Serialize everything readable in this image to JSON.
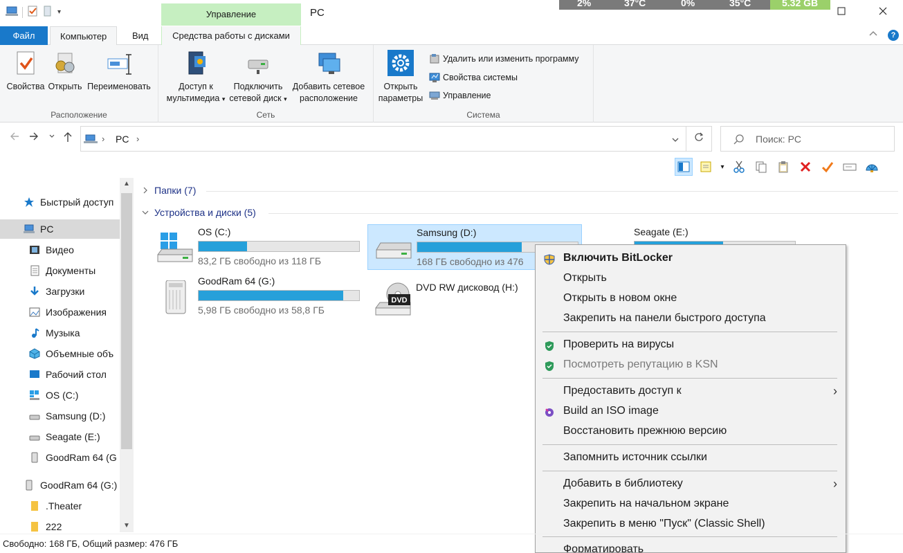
{
  "titlebar": {
    "context_tab": "Управление",
    "window_title": "PC",
    "perf": [
      "2%",
      "37°C",
      "0%",
      "35°C",
      "5.32 GB"
    ]
  },
  "tabs": {
    "file": "Файл",
    "computer": "Компьютер",
    "view": "Вид",
    "disk_tools": "Средства работы с дисками"
  },
  "ribbon": {
    "location": {
      "label": "Расположение",
      "properties": "Свойства",
      "open": "Открыть",
      "rename": "Переименовать"
    },
    "network": {
      "label": "Сеть",
      "media_line1": "Доступ к",
      "media_line2": "мультимедиа",
      "map_line1": "Подключить",
      "map_line2": "сетевой диск",
      "add_line1": "Добавить сетевое",
      "add_line2": "расположение"
    },
    "system": {
      "label": "Система",
      "settings_line1": "Открыть",
      "settings_line2": "параметры",
      "uninstall": "Удалить или изменить программу",
      "sysprops": "Свойства системы",
      "manage": "Управление"
    }
  },
  "address": {
    "path_item": "PC",
    "search_placeholder": "Поиск: PC"
  },
  "sidebar": {
    "items": [
      {
        "label": "Быстрый доступ",
        "icon": "star-icon"
      },
      {
        "label": "PC",
        "icon": "computer-icon"
      },
      {
        "label": "Видео",
        "icon": "video-icon"
      },
      {
        "label": "Документы",
        "icon": "documents-icon"
      },
      {
        "label": "Загрузки",
        "icon": "download-icon"
      },
      {
        "label": "Изображения",
        "icon": "pictures-icon"
      },
      {
        "label": "Музыка",
        "icon": "music-icon"
      },
      {
        "label": "Объемные объ",
        "icon": "3d-objects-icon"
      },
      {
        "label": "Рабочий стол",
        "icon": "desktop-icon"
      },
      {
        "label": "OS (C:)",
        "icon": "windows-drive-icon"
      },
      {
        "label": "Samsung (D:)",
        "icon": "drive-icon"
      },
      {
        "label": "Seagate (E:)",
        "icon": "drive-icon"
      },
      {
        "label": "GoodRam 64 (G",
        "icon": "usb-drive-icon"
      },
      {
        "label": "GoodRam 64 (G:)",
        "icon": "usb-drive-icon"
      },
      {
        "label": ".Theater",
        "icon": "folder-icon"
      },
      {
        "label": "222",
        "icon": "folder-icon"
      }
    ]
  },
  "content": {
    "folders_header": "Папки (7)",
    "devices_header": "Устройства и диски (5)",
    "drives": [
      {
        "name": "OS (C:)",
        "free": "83,2 ГБ свободно из 118 ГБ",
        "used_fraction": 0.3
      },
      {
        "name": "Samsung (D:)",
        "free": "168 ГБ свободно из 476",
        "used_fraction": 0.65
      },
      {
        "name": "Seagate (E:)",
        "free": "",
        "used_fraction": 0.55
      },
      {
        "name": "GoodRam 64 (G:)",
        "free": "5,98 ГБ свободно из 58,8 ГБ",
        "used_fraction": 0.9
      },
      {
        "name": "DVD RW дисковод (H:)",
        "free": ""
      }
    ]
  },
  "context_menu": {
    "items": [
      "Включить BitLocker",
      "Открыть",
      "Открыть в новом окне",
      "Закрепить на панели быстрого доступа",
      "Проверить на вирусы",
      "Посмотреть репутацию в KSN",
      "Предоставить доступ к",
      "Build an ISO image",
      "Восстановить прежнюю версию",
      "Запомнить источник ссылки",
      "Добавить в библиотеку",
      "Закрепить на начальном экране",
      "Закрепить в меню \"Пуск\" (Classic Shell)",
      "Форматировать"
    ]
  },
  "dvd_label": "DVD",
  "statusbar": {
    "text": "Свободно: 168 ГБ, Общий размер: 476 ГБ"
  },
  "colors": {
    "accent": "#1979ca",
    "bar_fill": "#26a0da",
    "selection": "#cce8ff",
    "context_tab": "#c6efc1"
  }
}
